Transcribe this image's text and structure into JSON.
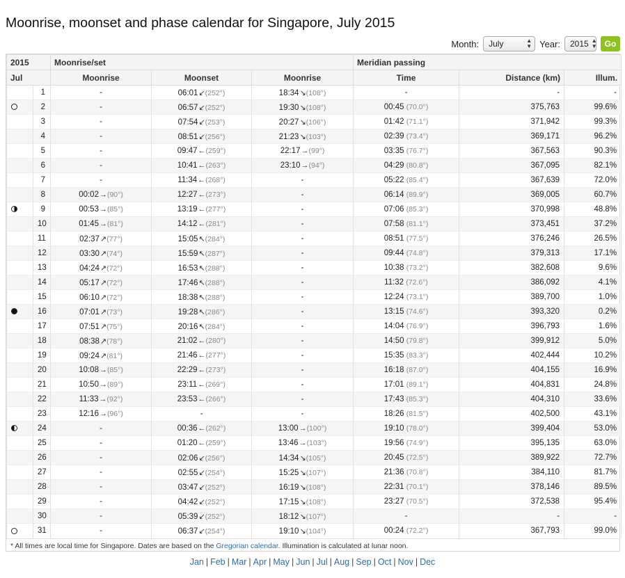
{
  "page": {
    "title": "Moonrise, moonset and phase calendar for Singapore, July 2015"
  },
  "controls": {
    "month_label": "Month:",
    "month_value": "July",
    "year_label": "Year:",
    "year_value": "2015",
    "go_label": "Go"
  },
  "table": {
    "header_year": "2015",
    "header_group_rise_set": "Moonrise/set",
    "header_group_meridian": "Meridian passing",
    "col_month": "Jul",
    "col_moonrise": "Moonrise",
    "col_moonset": "Moonset",
    "col_moonrise2": "Moonrise",
    "col_time": "Time",
    "col_distance": "Distance (km)",
    "col_illum": "Illum.",
    "rows": [
      {
        "phase": "",
        "day": "1",
        "rise1": "-",
        "rise1_deg": "",
        "rise1_arrow": "",
        "set": "06:01",
        "set_arrow": "↙",
        "set_deg": "(252°)",
        "rise2": "18:34",
        "rise2_arrow": "↘",
        "rise2_deg": "(108°)",
        "mtime": "-",
        "mdeg": "",
        "dist": "-",
        "illum": "-"
      },
      {
        "phase": "full",
        "day": "2",
        "rise1": "-",
        "rise1_deg": "",
        "rise1_arrow": "",
        "set": "06:57",
        "set_arrow": "↙",
        "set_deg": "(252°)",
        "rise2": "19:30",
        "rise2_arrow": "↘",
        "rise2_deg": "(108°)",
        "mtime": "00:45",
        "mdeg": "(70.0°)",
        "dist": "375,763",
        "illum": "99.6%"
      },
      {
        "phase": "",
        "day": "3",
        "rise1": "-",
        "rise1_deg": "",
        "rise1_arrow": "",
        "set": "07:54",
        "set_arrow": "↙",
        "set_deg": "(253°)",
        "rise2": "20:27",
        "rise2_arrow": "↘",
        "rise2_deg": "(106°)",
        "mtime": "01:42",
        "mdeg": "(71.1°)",
        "dist": "371,942",
        "illum": "99.3%"
      },
      {
        "phase": "",
        "day": "4",
        "rise1": "-",
        "rise1_deg": "",
        "rise1_arrow": "",
        "set": "08:51",
        "set_arrow": "↙",
        "set_deg": "(256°)",
        "rise2": "21:23",
        "rise2_arrow": "↘",
        "rise2_deg": "(103°)",
        "mtime": "02:39",
        "mdeg": "(73.4°)",
        "dist": "369,171",
        "illum": "96.2%"
      },
      {
        "phase": "",
        "day": "5",
        "rise1": "-",
        "rise1_deg": "",
        "rise1_arrow": "",
        "set": "09:47",
        "set_arrow": "←",
        "set_deg": "(259°)",
        "rise2": "22:17",
        "rise2_arrow": "→",
        "rise2_deg": "(99°)",
        "mtime": "03:35",
        "mdeg": "(76.7°)",
        "dist": "367,563",
        "illum": "90.3%"
      },
      {
        "phase": "",
        "day": "6",
        "rise1": "-",
        "rise1_deg": "",
        "rise1_arrow": "",
        "set": "10:41",
        "set_arrow": "←",
        "set_deg": "(263°)",
        "rise2": "23:10",
        "rise2_arrow": "→",
        "rise2_deg": "(94°)",
        "mtime": "04:29",
        "mdeg": "(80.8°)",
        "dist": "367,095",
        "illum": "82.1%"
      },
      {
        "phase": "",
        "day": "7",
        "rise1": "-",
        "rise1_deg": "",
        "rise1_arrow": "",
        "set": "11:34",
        "set_arrow": "←",
        "set_deg": "(268°)",
        "rise2": "-",
        "rise2_arrow": "",
        "rise2_deg": "",
        "mtime": "05:22",
        "mdeg": "(85.4°)",
        "dist": "367,639",
        "illum": "72.0%"
      },
      {
        "phase": "",
        "day": "8",
        "rise1": "00:02",
        "rise1_arrow": "→",
        "rise1_deg": "(90°)",
        "set": "12:27",
        "set_arrow": "←",
        "set_deg": "(273°)",
        "rise2": "-",
        "rise2_arrow": "",
        "rise2_deg": "",
        "mtime": "06:14",
        "mdeg": "(89.9°)",
        "dist": "369,005",
        "illum": "60.7%"
      },
      {
        "phase": "lq",
        "day": "9",
        "rise1": "00:53",
        "rise1_arrow": "→",
        "rise1_deg": "(85°)",
        "set": "13:19",
        "set_arrow": "←",
        "set_deg": "(277°)",
        "rise2": "-",
        "rise2_arrow": "",
        "rise2_deg": "",
        "mtime": "07:06",
        "mdeg": "(85.3°)",
        "dist": "370,998",
        "illum": "48.8%"
      },
      {
        "phase": "",
        "day": "10",
        "rise1": "01:45",
        "rise1_arrow": "→",
        "rise1_deg": "(81°)",
        "set": "14:12",
        "set_arrow": "←",
        "set_deg": "(281°)",
        "rise2": "-",
        "rise2_arrow": "",
        "rise2_deg": "",
        "mtime": "07:58",
        "mdeg": "(81.1°)",
        "dist": "373,451",
        "illum": "37.2%"
      },
      {
        "phase": "",
        "day": "11",
        "rise1": "02:37",
        "rise1_arrow": "↗",
        "rise1_deg": "(77°)",
        "set": "15:05",
        "set_arrow": "↖",
        "set_deg": "(284°)",
        "rise2": "-",
        "rise2_arrow": "",
        "rise2_deg": "",
        "mtime": "08:51",
        "mdeg": "(77.5°)",
        "dist": "376,246",
        "illum": "26.5%"
      },
      {
        "phase": "",
        "day": "12",
        "rise1": "03:30",
        "rise1_arrow": "↗",
        "rise1_deg": "(74°)",
        "set": "15:59",
        "set_arrow": "↖",
        "set_deg": "(287°)",
        "rise2": "-",
        "rise2_arrow": "",
        "rise2_deg": "",
        "mtime": "09:44",
        "mdeg": "(74.8°)",
        "dist": "379,313",
        "illum": "17.1%"
      },
      {
        "phase": "",
        "day": "13",
        "rise1": "04:24",
        "rise1_arrow": "↗",
        "rise1_deg": "(72°)",
        "set": "16:53",
        "set_arrow": "↖",
        "set_deg": "(288°)",
        "rise2": "-",
        "rise2_arrow": "",
        "rise2_deg": "",
        "mtime": "10:38",
        "mdeg": "(73.2°)",
        "dist": "382,608",
        "illum": "9.6%"
      },
      {
        "phase": "",
        "day": "14",
        "rise1": "05:17",
        "rise1_arrow": "↗",
        "rise1_deg": "(72°)",
        "set": "17:46",
        "set_arrow": "↖",
        "set_deg": "(288°)",
        "rise2": "-",
        "rise2_arrow": "",
        "rise2_deg": "",
        "mtime": "11:32",
        "mdeg": "(72.6°)",
        "dist": "386,092",
        "illum": "4.1%"
      },
      {
        "phase": "",
        "day": "15",
        "rise1": "06:10",
        "rise1_arrow": "↗",
        "rise1_deg": "(72°)",
        "set": "18:38",
        "set_arrow": "↖",
        "set_deg": "(288°)",
        "rise2": "-",
        "rise2_arrow": "",
        "rise2_deg": "",
        "mtime": "12:24",
        "mdeg": "(73.1°)",
        "dist": "389,700",
        "illum": "1.0%"
      },
      {
        "phase": "new",
        "day": "16",
        "rise1": "07:01",
        "rise1_arrow": "↗",
        "rise1_deg": "(73°)",
        "set": "19:28",
        "set_arrow": "↖",
        "set_deg": "(286°)",
        "rise2": "-",
        "rise2_arrow": "",
        "rise2_deg": "",
        "mtime": "13:15",
        "mdeg": "(74.6°)",
        "dist": "393,320",
        "illum": "0.2%"
      },
      {
        "phase": "",
        "day": "17",
        "rise1": "07:51",
        "rise1_arrow": "↗",
        "rise1_deg": "(75°)",
        "set": "20:16",
        "set_arrow": "↖",
        "set_deg": "(284°)",
        "rise2": "-",
        "rise2_arrow": "",
        "rise2_deg": "",
        "mtime": "14:04",
        "mdeg": "(76.9°)",
        "dist": "396,793",
        "illum": "1.6%"
      },
      {
        "phase": "",
        "day": "18",
        "rise1": "08:38",
        "rise1_arrow": "↗",
        "rise1_deg": "(78°)",
        "set": "21:02",
        "set_arrow": "←",
        "set_deg": "(280°)",
        "rise2": "-",
        "rise2_arrow": "",
        "rise2_deg": "",
        "mtime": "14:50",
        "mdeg": "(79.8°)",
        "dist": "399,912",
        "illum": "5.0%"
      },
      {
        "phase": "",
        "day": "19",
        "rise1": "09:24",
        "rise1_arrow": "↗",
        "rise1_deg": "(81°)",
        "set": "21:46",
        "set_arrow": "←",
        "set_deg": "(277°)",
        "rise2": "-",
        "rise2_arrow": "",
        "rise2_deg": "",
        "mtime": "15:35",
        "mdeg": "(83.3°)",
        "dist": "402,444",
        "illum": "10.2%"
      },
      {
        "phase": "",
        "day": "20",
        "rise1": "10:08",
        "rise1_arrow": "→",
        "rise1_deg": "(85°)",
        "set": "22:29",
        "set_arrow": "←",
        "set_deg": "(273°)",
        "rise2": "-",
        "rise2_arrow": "",
        "rise2_deg": "",
        "mtime": "16:18",
        "mdeg": "(87.0°)",
        "dist": "404,155",
        "illum": "16.9%"
      },
      {
        "phase": "",
        "day": "21",
        "rise1": "10:50",
        "rise1_arrow": "→",
        "rise1_deg": "(89°)",
        "set": "23:11",
        "set_arrow": "←",
        "set_deg": "(269°)",
        "rise2": "-",
        "rise2_arrow": "",
        "rise2_deg": "",
        "mtime": "17:01",
        "mdeg": "(89.1°)",
        "dist": "404,831",
        "illum": "24.8%"
      },
      {
        "phase": "",
        "day": "22",
        "rise1": "11:33",
        "rise1_arrow": "→",
        "rise1_deg": "(92°)",
        "set": "23:53",
        "set_arrow": "←",
        "set_deg": "(266°)",
        "rise2": "-",
        "rise2_arrow": "",
        "rise2_deg": "",
        "mtime": "17:43",
        "mdeg": "(85.3°)",
        "dist": "404,310",
        "illum": "33.6%"
      },
      {
        "phase": "",
        "day": "23",
        "rise1": "12:16",
        "rise1_arrow": "→",
        "rise1_deg": "(96°)",
        "set": "-",
        "set_arrow": "",
        "set_deg": "",
        "rise2": "-",
        "rise2_arrow": "",
        "rise2_deg": "",
        "mtime": "18:26",
        "mdeg": "(81.5°)",
        "dist": "402,500",
        "illum": "43.1%"
      },
      {
        "phase": "fq",
        "day": "24",
        "rise1": "-",
        "rise1_arrow": "",
        "rise1_deg": "",
        "set": "00:36",
        "set_arrow": "←",
        "set_deg": "(262°)",
        "rise2": "13:00",
        "rise2_arrow": "→",
        "rise2_deg": "(100°)",
        "mtime": "19:10",
        "mdeg": "(78.0°)",
        "dist": "399,404",
        "illum": "53.0%"
      },
      {
        "phase": "",
        "day": "25",
        "rise1": "-",
        "rise1_arrow": "",
        "rise1_deg": "",
        "set": "01:20",
        "set_arrow": "←",
        "set_deg": "(259°)",
        "rise2": "13:46",
        "rise2_arrow": "→",
        "rise2_deg": "(103°)",
        "mtime": "19:56",
        "mdeg": "(74.9°)",
        "dist": "395,135",
        "illum": "63.0%"
      },
      {
        "phase": "",
        "day": "26",
        "rise1": "-",
        "rise1_arrow": "",
        "rise1_deg": "",
        "set": "02:06",
        "set_arrow": "↙",
        "set_deg": "(256°)",
        "rise2": "14:34",
        "rise2_arrow": "↘",
        "rise2_deg": "(105°)",
        "mtime": "20:45",
        "mdeg": "(72.5°)",
        "dist": "389,922",
        "illum": "72.7%"
      },
      {
        "phase": "",
        "day": "27",
        "rise1": "-",
        "rise1_arrow": "",
        "rise1_deg": "",
        "set": "02:55",
        "set_arrow": "↙",
        "set_deg": "(254°)",
        "rise2": "15:25",
        "rise2_arrow": "↘",
        "rise2_deg": "(107°)",
        "mtime": "21:36",
        "mdeg": "(70.8°)",
        "dist": "384,110",
        "illum": "81.7%"
      },
      {
        "phase": "",
        "day": "28",
        "rise1": "-",
        "rise1_arrow": "",
        "rise1_deg": "",
        "set": "03:47",
        "set_arrow": "↙",
        "set_deg": "(252°)",
        "rise2": "16:19",
        "rise2_arrow": "↘",
        "rise2_deg": "(108°)",
        "mtime": "22:31",
        "mdeg": "(70.1°)",
        "dist": "378,146",
        "illum": "89.5%"
      },
      {
        "phase": "",
        "day": "29",
        "rise1": "-",
        "rise1_arrow": "",
        "rise1_deg": "",
        "set": "04:42",
        "set_arrow": "↙",
        "set_deg": "(252°)",
        "rise2": "17:15",
        "rise2_arrow": "↘",
        "rise2_deg": "(108°)",
        "mtime": "23:27",
        "mdeg": "(70.5°)",
        "dist": "372,538",
        "illum": "95.4%"
      },
      {
        "phase": "",
        "day": "30",
        "rise1": "-",
        "rise1_arrow": "",
        "rise1_deg": "",
        "set": "05:39",
        "set_arrow": "↙",
        "set_deg": "(252°)",
        "rise2": "18:12",
        "rise2_arrow": "↘",
        "rise2_deg": "(107°)",
        "mtime": "-",
        "mdeg": "",
        "dist": "-",
        "illum": "-"
      },
      {
        "phase": "full",
        "day": "31",
        "rise1": "-",
        "rise1_arrow": "",
        "rise1_deg": "",
        "set": "06:37",
        "set_arrow": "↙",
        "set_deg": "(254°)",
        "rise2": "19:10",
        "rise2_arrow": "↘",
        "rise2_deg": "(104°)",
        "mtime": "00:24",
        "mdeg": "(72.2°)",
        "dist": "367,793",
        "illum": "99.0%"
      }
    ]
  },
  "footnote": {
    "before": "* All times are local time for Singapore. Dates are based on the ",
    "link": "Gregorian calendar",
    "after": ". Illumination is calculated at lunar noon."
  },
  "months": [
    "Jan",
    "Feb",
    "Mar",
    "Apr",
    "May",
    "Jun",
    "Jul",
    "Aug",
    "Sep",
    "Oct",
    "Nov",
    "Dec"
  ],
  "colors": {
    "go_button": "#8ec220",
    "link": "#2a6db3",
    "stripe": "#f5f5f5"
  },
  "icons": {
    "full": "full-moon-icon",
    "new": "new-moon-icon",
    "lq": "last-quarter-icon",
    "fq": "first-quarter-icon"
  }
}
